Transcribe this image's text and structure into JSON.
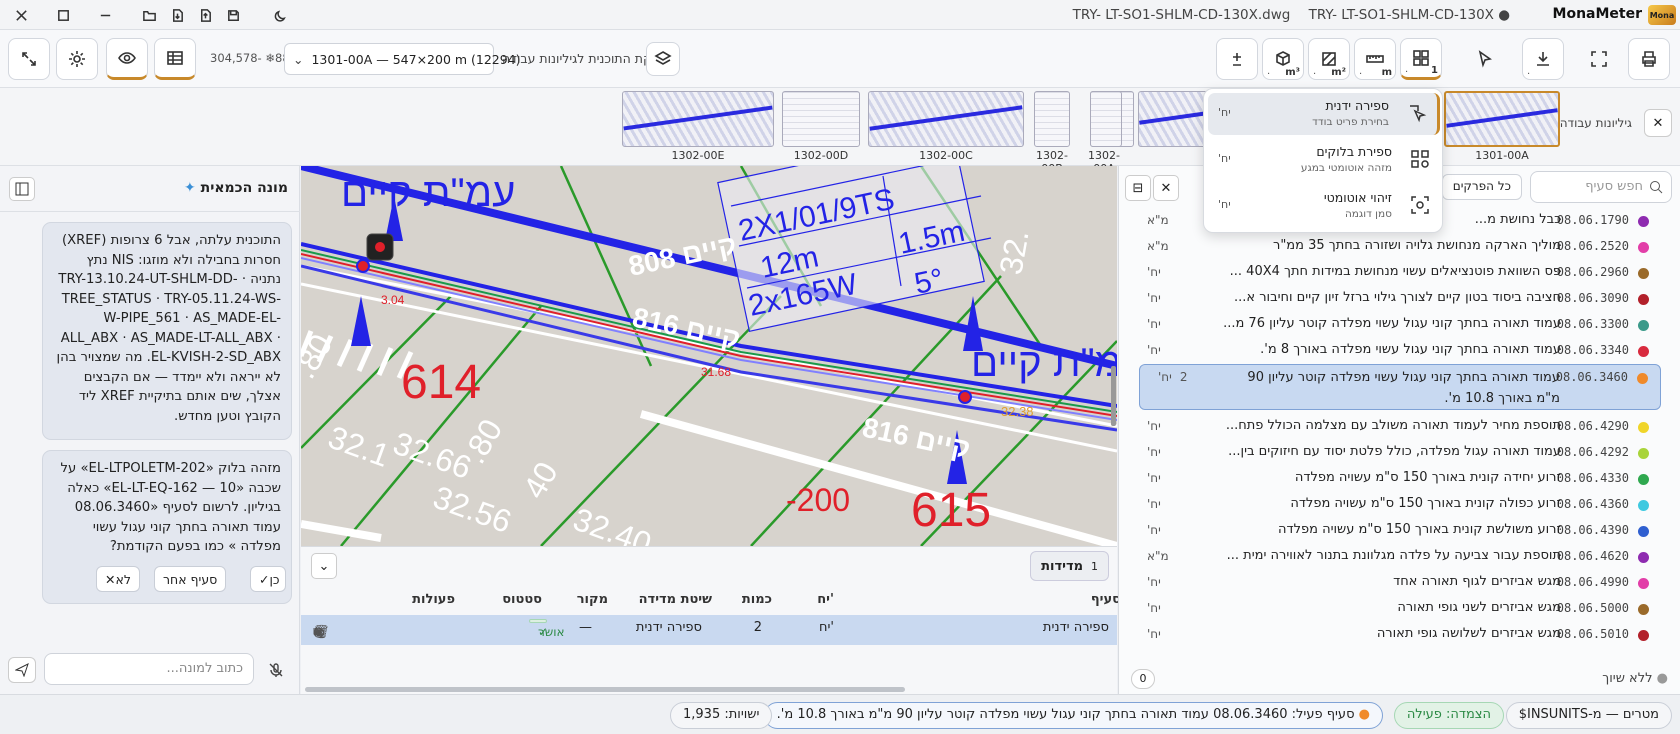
{
  "titlebar": {
    "tabs": [
      "TRY- LT-SO1-SHLM-CD-130X.dwg",
      "TRY- LT-SO1-SHLM-CD-130X"
    ],
    "app_name": "MonaMeter",
    "logo_text": "Mona"
  },
  "toolbar": {
    "sheet_select": "1301-00A — 547×200 m (12294)",
    "split_label": "חלוקת התוכנית לגיליונות עבודה",
    "scale_info": "304,578- ❄88",
    "count_badge": "1",
    "area_unit": "m²",
    "length_unit": "m",
    "volume_unit": "m³"
  },
  "thumbnails": {
    "title": "גיליונות עבודה",
    "items": [
      {
        "label": "1301-00A"
      },
      {
        "label": ""
      },
      {
        "label": ""
      },
      {
        "label": "1302-00A"
      },
      {
        "label": "1302-00B"
      },
      {
        "label": "1302-00C"
      },
      {
        "label": "1302-00D"
      },
      {
        "label": "1302-00E"
      }
    ]
  },
  "popup": {
    "items": [
      {
        "title": "ספירה ידנית",
        "subtitle": "בחירת פריט בודד",
        "unit": "יח'"
      },
      {
        "title": "ספירת בלוקים",
        "subtitle": "מזהה אוטומטי במגע",
        "unit": "יח'"
      },
      {
        "title": "זיהוי אוטומטי",
        "subtitle": "סמן דוגמה",
        "unit": "יח'"
      }
    ]
  },
  "ai_panel": {
    "title": "מונה הכמאית",
    "message1": "התוכנית עלתה, אבל 6 צרופות (XREF) חסרות בחבילה ולא מוזגו: NIS נתץ נתניה · TRY-13.10.24-UT-SHLM-DD-TREE_STATUS · TRY-05.11.24-WS-W-PIPE_561 · AS_MADE-EL-ALL_ABX · AS_MADE-LT-ALL_ABX · EL-KVISH-2-SD_ABX. מה שמצויר בהן לא ייראה ולא יימדד — אם הקבצים אצלך, שים אותם בתיקיית XREF ליד הקובץ וטען מחדש.",
    "message2": "מזהה בלוק «EL-LTPOLETM-202» על שכבה «10 — EL-LT-EQ-162» כאלה בגיליון. לרשום לסעיף «08.06.3460 עמוד תאורה בחתך קוני עגול עשוי מפלדה » כמו בפעם הקודמת?",
    "chip_yes": "כן",
    "chip_other": "סעיף אחר",
    "chip_no": "לא",
    "input_placeholder": "כתוב למונה..."
  },
  "canvas": {
    "labels": {
      "exist1": "עמ\"ת קיים",
      "exist2": "עמ\"ת קיים",
      "box1": "2X1/01/9TS",
      "box2": "12m",
      "box3": "1.5m",
      "box4": "2x165W",
      "box5": "5°",
      "road1": "808 קיים",
      "road2": "816 קיים",
      "road3": "816 קיים",
      "n614": "614",
      "n615": "615",
      "n200": "-200",
      "e1": "32.66",
      "e2": "32.56",
      "e3": "32.40",
      "e4": "32.1",
      "e5": "40",
      "e6": ".80",
      "e7": ".80",
      "e8": "32.",
      "e9": "32.38",
      "red1": "31.68",
      "red2": "3.04"
    }
  },
  "measurements": {
    "tab_label": "מדידות",
    "tab_count": "1",
    "columns": {
      "item": "סעיף",
      "unit": "יח'",
      "qty": "כמות",
      "method": "שיטת מדידה",
      "source": "מקור",
      "status": "סטטוס",
      "actions": "פעולות"
    },
    "row": {
      "item": "ספירה ידנית",
      "unit": "יח'",
      "qty": "2",
      "method": "ספירה ידנית",
      "source": "—",
      "status": "אושר"
    }
  },
  "item_list": {
    "search_placeholder": "חפש סעיף",
    "filter_all": "כל הפרקים",
    "items": [
      {
        "code": "08.06.1790",
        "text": "כבל נחושת מ...",
        "unit": "מ\"א",
        "color": "#8e2bb0"
      },
      {
        "code": "08.06.2520",
        "text": "מוליך הארקה מנחושת גלויה ושזורה בחתך 35 ממ\"ר",
        "unit": "מ\"א",
        "color": "#e23ea8"
      },
      {
        "code": "08.06.2960",
        "text": "פס השוואת פוטנציאלים עשוי מנחושת במידות חתך 40X4 ...",
        "unit": "יח'",
        "color": "#9a6a2a"
      },
      {
        "code": "08.06.3090",
        "text": "חציבה ביסוד בטון קיים לצורך גילוי ברזל זיון קיים וחיבור א...",
        "unit": "יח'",
        "color": "#b2202a"
      },
      {
        "code": "08.06.3300",
        "text": "עמוד תאורה בחתך קוני עגול עשוי מפלדה קוטר עליון 76 מ...",
        "unit": "יח'",
        "color": "#3b9a8a"
      },
      {
        "code": "08.06.3340",
        "text": "עמוד תאורה בחתך קוני עגול עשוי מפלדה באורך 8 מ'.",
        "unit": "יח'",
        "color": "#d82a3e"
      },
      {
        "code": "08.06.3460",
        "text": "עמוד תאורה בחתך קוני עגול עשוי מפלדה קוטר עליון 90 מ\"מ באורך 10.8 מ'.",
        "unit": "יח'",
        "count": "2",
        "color": "#f08a2a"
      },
      {
        "code": "08.06.4290",
        "text": "תוספת מחיר לעמוד תאורה משולב עם מצלמה הכולל פתח...",
        "unit": "יח'",
        "color": "#f0d52a"
      },
      {
        "code": "08.06.4292",
        "text": "עמוד תאורה עגול מפלדה, כולל פלטת יסוד עם חיזוקים בין...",
        "unit": "יח'",
        "color": "#a9d43a"
      },
      {
        "code": "08.06.4330",
        "text": "זרוע יחידה קונית באורך 150 ס\"מ עשויה מפלדה",
        "unit": "יח'",
        "color": "#2fa84f"
      },
      {
        "code": "08.06.4360",
        "text": "זרוע כפולה קונית באורך 150 ס\"מ עשויה מפלדה",
        "unit": "יח'",
        "color": "#3ec9e0"
      },
      {
        "code": "08.06.4390",
        "text": "זרוע משולשת קונית באורך 150 ס\"מ עשויה מפלדה",
        "unit": "יח'",
        "color": "#2f5fd0"
      },
      {
        "code": "08.06.4620",
        "text": "תוספת עבור צביעה על פלדה מגלוונת בתנור לאווירה ימית ...",
        "unit": "מ\"א",
        "color": "#8e2bb0"
      },
      {
        "code": "08.06.4990",
        "text": "מגש אביזרים לגוף תאורה אחד",
        "unit": "יח'",
        "color": "#e23ea8"
      },
      {
        "code": "08.06.5000",
        "text": "מגש אביזרים לשני גופי תאורה",
        "unit": "יח'",
        "color": "#9a6a2a"
      },
      {
        "code": "08.06.5010",
        "text": "מגש אביזרים לשלושה גופי תאורה",
        "unit": "יח'",
        "color": "#b2202a"
      }
    ],
    "no_link_label": "ללא שיוך",
    "no_link_count": "0"
  },
  "statusbar": {
    "units": "מטרים — מ-INSUNITS$",
    "snap": "הצמדה: פעילה",
    "active_item": "סעיף פעיל: 08.06.3460 עמוד תאורה בחתך קוני עגול עשוי מפלדה קוטר עליון 90 מ\"מ באורך 10.8 מ'.",
    "entities": "ישויות: 1,935"
  },
  "colors": {
    "accent": "#c8892a",
    "selection": "#c8d9f1",
    "drawing_blue": "#1f2fe0",
    "drawing_red": "#e0202a",
    "drawing_green": "#2a9a2a"
  }
}
